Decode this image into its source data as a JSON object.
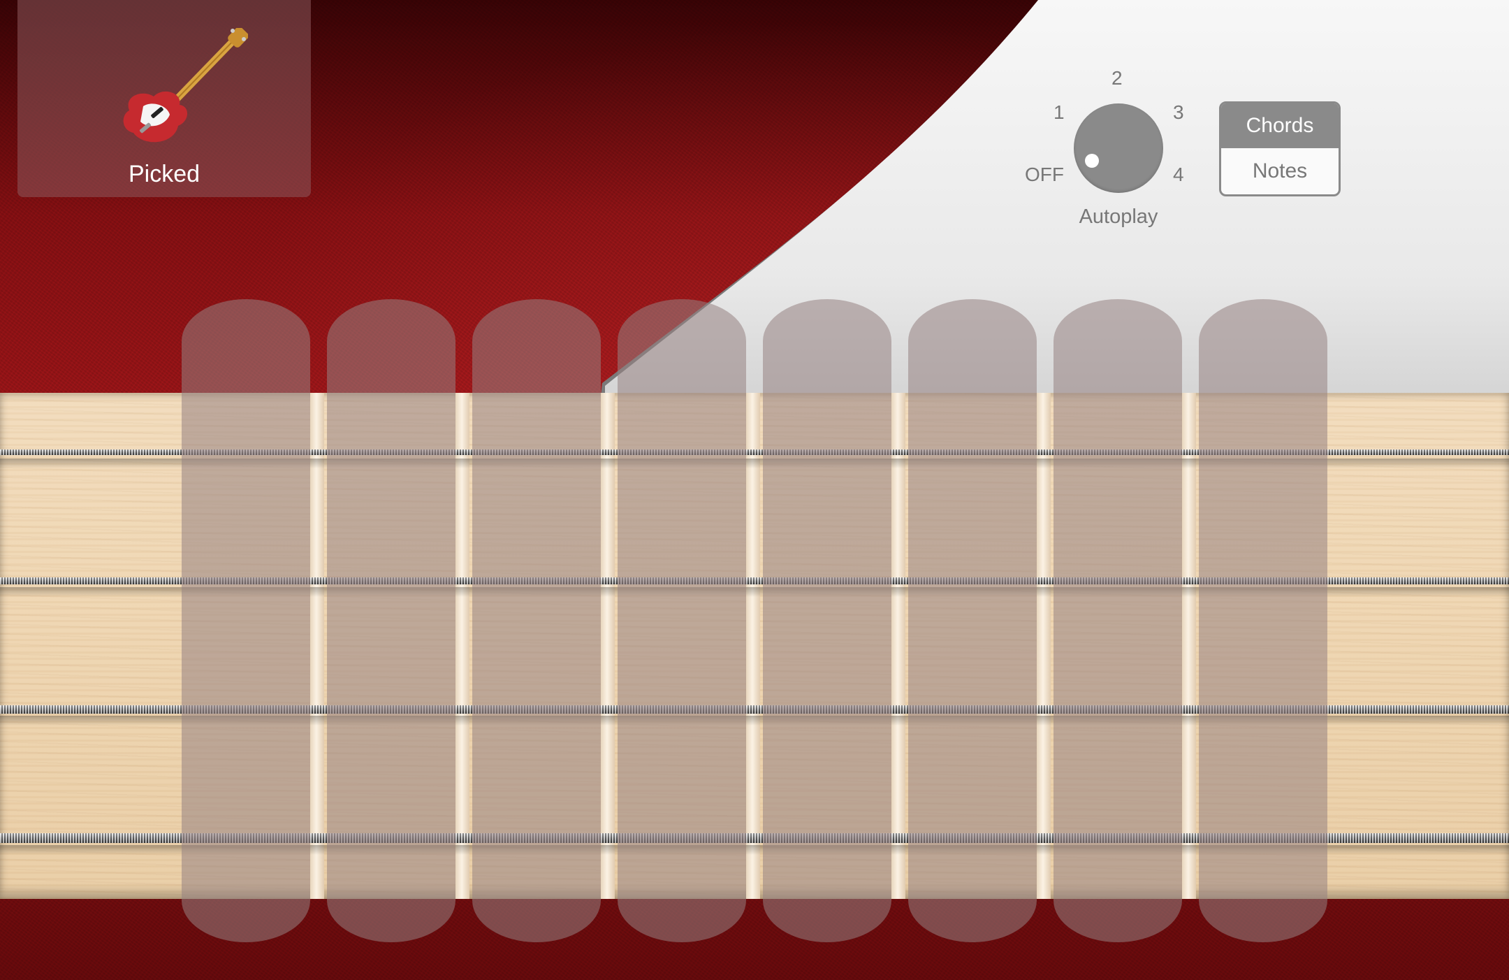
{
  "instrument": {
    "name": "Picked",
    "icon": "bass-guitar-icon"
  },
  "autoplay": {
    "label": "Autoplay",
    "positions": [
      "OFF",
      "1",
      "2",
      "3",
      "4"
    ],
    "selected": "OFF"
  },
  "mode": {
    "options": [
      "Chords",
      "Notes"
    ],
    "selected": "Chords"
  },
  "chord_strips": [
    {
      "index": 1
    },
    {
      "index": 2
    },
    {
      "index": 3
    },
    {
      "index": 4
    },
    {
      "index": 5
    },
    {
      "index": 6
    },
    {
      "index": 7
    },
    {
      "index": 8
    }
  ],
  "colors": {
    "body_red": "#9e1518",
    "pickguard": "#ececec",
    "fretboard_maple": "#efd6b2",
    "control_gray": "#8a8a8a"
  }
}
